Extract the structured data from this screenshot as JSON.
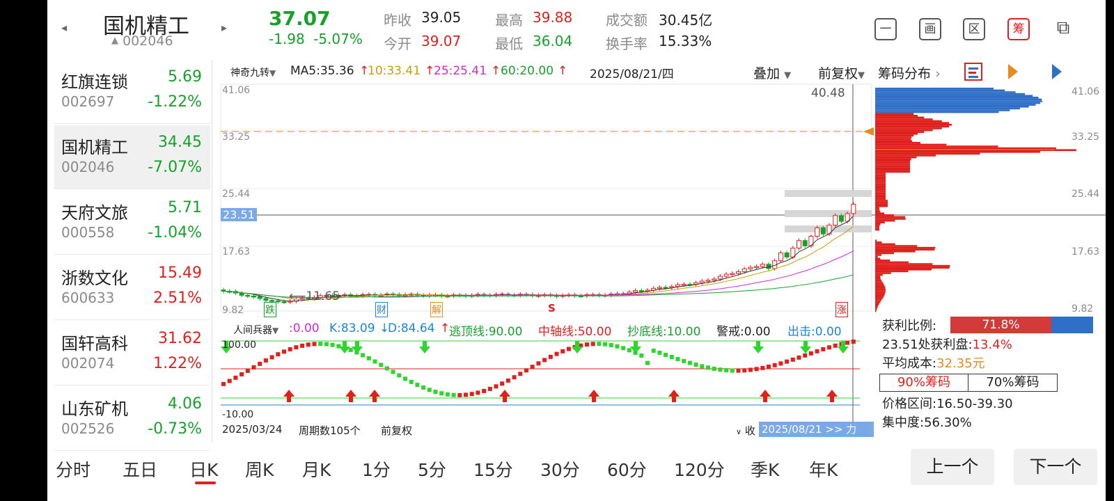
{
  "header": {
    "name": "国机精工",
    "code": "002046",
    "price": "37.07",
    "change": "-1.98",
    "change_pct": "-5.07%",
    "quotes": {
      "prev_close_label": "昨收",
      "prev_close": "39.05",
      "open_label": "今开",
      "open": "39.07",
      "high_label": "最高",
      "high": "39.88",
      "low_label": "最低",
      "low": "36.04",
      "turnover_amt_label": "成交额",
      "turnover_amt": "30.45亿",
      "turnover_rate_label": "换手率",
      "turnover_rate": "15.33%"
    },
    "tools": [
      "一",
      "画",
      "区",
      "筹",
      "⧉"
    ]
  },
  "sidebar": {
    "items": [
      {
        "name": "红旗连锁",
        "price": "5.69",
        "code": "002697",
        "pct": "-1.22%",
        "dir": "down"
      },
      {
        "name": "国机精工",
        "price": "34.45",
        "code": "002046",
        "pct": "-7.07%",
        "dir": "down"
      },
      {
        "name": "天府文旅",
        "price": "5.71",
        "code": "000558",
        "pct": "-1.04%",
        "dir": "down"
      },
      {
        "name": "浙数文化",
        "price": "15.49",
        "code": "600633",
        "pct": "2.51%",
        "dir": "up"
      },
      {
        "name": "国轩高科",
        "price": "31.62",
        "code": "002074",
        "pct": "1.22%",
        "dir": "up"
      },
      {
        "name": "山东矿机",
        "price": "4.06",
        "code": "002526",
        "pct": "-0.73%",
        "dir": "down"
      }
    ]
  },
  "kline": {
    "indicator_name": "神奇九转",
    "ma5": "MA5:35.36",
    "ma10": "10:33.41",
    "ma25": "25:25.41",
    "ma60": "60:20.00",
    "date": "2025/08/21/四",
    "overlay": "叠加",
    "adjust": "前复权",
    "y_labels": [
      "41.06",
      "33.25",
      "25.44",
      "17.63",
      "9.82"
    ],
    "crosshair_price": "23.51",
    "max_mark": "40.48",
    "min_mark": "11.65",
    "events": [
      "跌",
      "财",
      "解",
      "S",
      "涨"
    ]
  },
  "chips": {
    "title": "筹码分布",
    "y_labels": [
      "41.06",
      "33.25",
      "25.44",
      "17.63",
      "9.82"
    ],
    "profit_ratio_label": "获利比例:",
    "profit_ratio": "71.8%",
    "profit_at_label": "23.51处获利盘:",
    "profit_at": "13.4%",
    "avg_cost_label": "平均成本:",
    "avg_cost": "32.35元",
    "btn_90": "90%筹码",
    "btn_70": "70%筹码",
    "range_label": "价格区间:",
    "range": "16.50-39.30",
    "concentration_label": "集中度:",
    "concentration": "56.30%"
  },
  "sub": {
    "name": "人间兵器",
    "v0": ":0.00",
    "k": "K:83.09",
    "d": "D:84.64",
    "top": "逃顶线:90.00",
    "mid": "中轴线:50.00",
    "bottom": "抄底线:10.00",
    "warn": "警戒:0.00",
    "out": "出击:0.00",
    "y100": "100.00",
    "y10": "-10.00"
  },
  "footer": {
    "start_date": "2025/03/24",
    "period_count": "周期数105个",
    "adjust": "前复权",
    "collapse": "收",
    "end_date": "2025/08/21",
    "end_suffix": "力"
  },
  "tabs": [
    "分时",
    "五日",
    "日K",
    "周K",
    "月K",
    "1分",
    "5分",
    "15分",
    "30分",
    "60分",
    "120分",
    "季K",
    "年K"
  ],
  "nav": {
    "prev": "上一个",
    "next": "下一个"
  },
  "colors": {
    "up": "#e0201d",
    "down": "#16a12b",
    "accent": "#e0201d",
    "chip_blue": "#2f6fc7"
  }
}
